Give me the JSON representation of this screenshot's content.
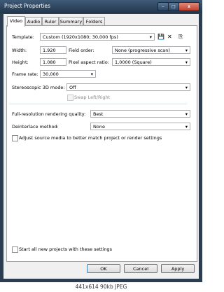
{
  "window": {
    "title": "Project Properties",
    "controls": {
      "minimize": "–",
      "maximize": "□",
      "close": "x"
    }
  },
  "tabs": [
    {
      "label": "Video",
      "active": true
    },
    {
      "label": "Audio"
    },
    {
      "label": "Ruler"
    },
    {
      "label": "Summary"
    },
    {
      "label": "Folders"
    }
  ],
  "video": {
    "template_label": "Template:",
    "template_value": "Custom (1920x1080; 30,000 fps)",
    "icons": {
      "save": "save-icon",
      "delete": "delete-icon",
      "match_media": "match-media-icon"
    },
    "width_label": "Width:",
    "width_value": "1.920",
    "height_label": "Height:",
    "height_value": "1.080",
    "field_order_label": "Field order:",
    "field_order_value": "None (progressive scan)",
    "par_label": "Pixel aspect ratio:",
    "par_value": "1,0000 (Square)",
    "frame_rate_label": "Frame rate:",
    "frame_rate_value": "30,000",
    "stereo_label": "Stereoscopic 3D mode:",
    "stereo_value": "Off",
    "swap_label": "Swap Left/Right",
    "render_quality_label": "Full-resolution rendering quality:",
    "render_quality_value": "Best",
    "deinterlace_label": "Deinterlace method:",
    "deinterlace_value": "None",
    "adjust_label": "Adjust source media to better match project or render settings",
    "start_all_label": "Start all new projects with these settings"
  },
  "buttons": {
    "ok": "OK",
    "cancel": "Cancel",
    "apply": "Apply"
  },
  "caption": "441x614  90kb  JPEG"
}
